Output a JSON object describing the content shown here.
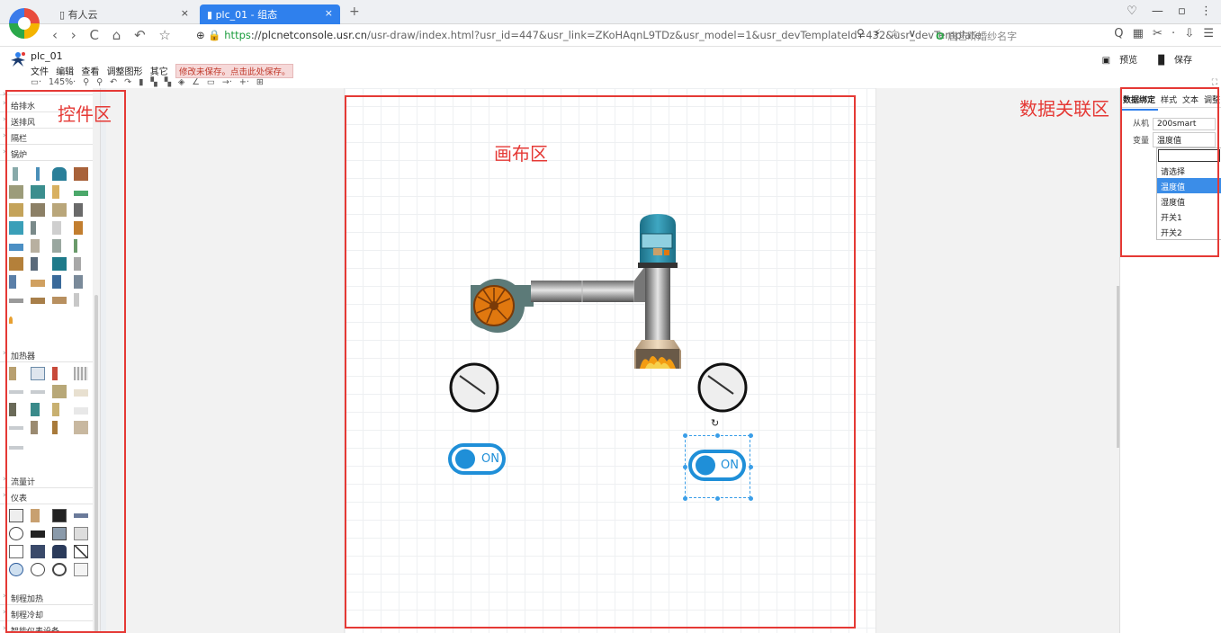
{
  "browser": {
    "tabs": [
      {
        "label": "有人云",
        "close": "×"
      },
      {
        "label": "plc_01 - 组态",
        "close": "×"
      }
    ],
    "new_tab": "+",
    "window_controls": "♡  —  ▫  ⋮",
    "nav_buttons": "‹ › C ⌂ ↶ ☆",
    "url_secure": "https",
    "url_domain": "://plcnetconsole.usr.cn",
    "url_path": "/usr-draw/index.html?usr_id=447&usr_link=ZKoHAqnL9TDz&usr_model=1&usr_devTemplateId=432&usr_devTemplate",
    "url_icons": "⚲ ⚡ ☆  ∨",
    "search_placeholder": "唐艺昕婚纱名字",
    "right_icons": "Q  ▦  ✂ ·  ⇩  ☰"
  },
  "app": {
    "name": "plc_01",
    "menus": [
      "文件",
      "编辑",
      "查看",
      "调整图形",
      "其它"
    ],
    "unsaved_notice": "修改未保存。点击此处保存。",
    "preview_label": "预览",
    "save_label": "保存",
    "tool_strip": "▭· 145%· ⚲ ⚲ ↶ ↷ ▮ ▚ ▚ ◈ ∠ ▭ →· +· ⊞",
    "collapse": "⛶"
  },
  "sidebar": {
    "categories_top": [
      "给排水",
      "送排风",
      "隔栏",
      "锅炉"
    ],
    "categories_mid": [
      "加热器"
    ],
    "categories_lower": [
      "流量计",
      "仪表"
    ],
    "categories_bottom": [
      "制程加热",
      "制程冷却",
      "智能仪表设备"
    ]
  },
  "annotations": {
    "widgets": "控件区",
    "canvas": "画布区",
    "data_link": "数据关联区"
  },
  "canvas": {
    "toggle1_text": "ON",
    "toggle2_text": "ON",
    "rotate_handle": "↻"
  },
  "right_panel": {
    "tabs": [
      "数据绑定",
      "样式",
      "文本",
      "调整"
    ],
    "slave_label": "从机",
    "slave_value": "200smart",
    "var_label": "变量",
    "var_value": "温度值",
    "options": [
      "请选择",
      "温度值",
      "湿度值",
      "开关1",
      "开关2"
    ],
    "selected_index": 1
  },
  "colors": {
    "annotation_red": "#e53935",
    "accent_blue": "#2f80ed",
    "toggle_blue": "#1f8fd8"
  }
}
